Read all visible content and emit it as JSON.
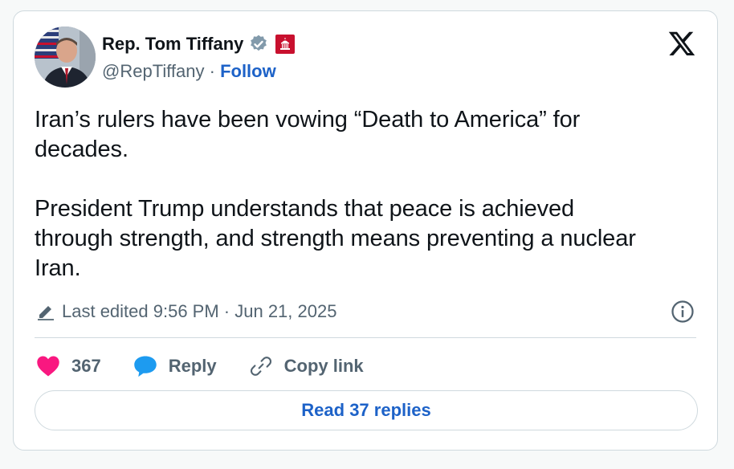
{
  "author": {
    "name": "Rep. Tom Tiffany",
    "handle": "@RepTiffany",
    "separator": " · ",
    "follow_label": "Follow"
  },
  "tweet": {
    "text": "Iran’s rulers have been vowing “Death to America” for\ndecades.\n\nPresident Trump understands that peace is achieved\nthrough strength, and strength means preventing a nuclear\nIran."
  },
  "meta": {
    "edited_label": "Last edited 9:56 PM · Jun 21, 2025"
  },
  "actions": {
    "like_count": "367",
    "reply_label": "Reply",
    "copy_link_label": "Copy link"
  },
  "replies_button": {
    "label": "Read 37 replies"
  },
  "icons": {
    "verified": "verified-badge-icon",
    "government": "government-capitol-badge-icon",
    "x_logo": "x-logo-icon",
    "edit": "pencil-icon",
    "info": "info-icon",
    "like": "heart-icon",
    "reply": "speech-bubble-icon",
    "copy_link": "link-icon"
  },
  "colors": {
    "accent": "#1d62c8",
    "like": "#f91880",
    "reply": "#1d9bf0",
    "verified": "#829aab",
    "gov_badge": "#c8102e",
    "muted": "#536471",
    "border": "#cfd9de"
  }
}
